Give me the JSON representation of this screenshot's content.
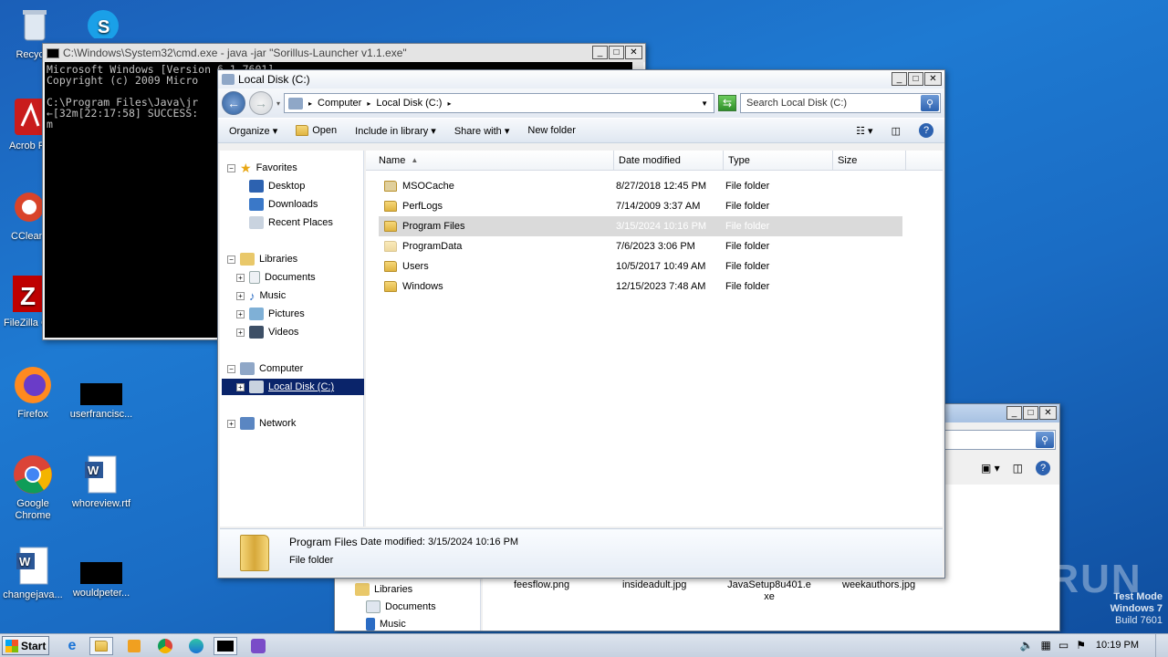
{
  "desktop": {
    "icons": [
      {
        "label": "Recycle"
      },
      {
        "label": "Acrob Reader"
      },
      {
        "label": "CClean"
      },
      {
        "label": "FileZilla C"
      },
      {
        "label": "Firefox"
      },
      {
        "label": "userfrancisc..."
      },
      {
        "label": "Google Chrome"
      },
      {
        "label": "whoreview.rtf"
      },
      {
        "label": "changejava..."
      },
      {
        "label": "wouldpeter..."
      }
    ]
  },
  "cmd_window": {
    "title": "C:\\Windows\\System32\\cmd.exe - java  -jar \"Sorillus-Launcher v1.1.exe\"",
    "lines": [
      "Microsoft Windows [Version 6.1.7601]",
      "Copyright (c) 2009 Micro",
      "",
      "C:\\Program Files\\Java\\jr",
      "←[32m[22:17:58] SUCCESS:",
      "m"
    ]
  },
  "explorer": {
    "title": "Local Disk (C:)",
    "address": {
      "crumbs": [
        "Computer",
        "Local Disk (C:)"
      ]
    },
    "search_placeholder": "Search Local Disk (C:)",
    "commands": {
      "organize": "Organize",
      "open": "Open",
      "include": "Include in library",
      "share": "Share with",
      "newfolder": "New folder"
    },
    "nav": {
      "favorites": "Favorites",
      "desktop": "Desktop",
      "downloads": "Downloads",
      "recent": "Recent Places",
      "libraries": "Libraries",
      "documents": "Documents",
      "music": "Music",
      "pictures": "Pictures",
      "videos": "Videos",
      "computer": "Computer",
      "localdisk": "Local Disk (C:)",
      "network": "Network"
    },
    "columns": {
      "name": "Name",
      "date": "Date modified",
      "type": "Type",
      "size": "Size"
    },
    "files": [
      {
        "name": "MSOCache",
        "date": "8/27/2018 12:45 PM",
        "type": "File folder"
      },
      {
        "name": "PerfLogs",
        "date": "7/14/2009 3:37 AM",
        "type": "File folder"
      },
      {
        "name": "Program Files",
        "date": "3/15/2024 10:16 PM",
        "type": "File folder"
      },
      {
        "name": "ProgramData",
        "date": "7/6/2023 3:06 PM",
        "type": "File folder"
      },
      {
        "name": "Users",
        "date": "10/5/2017 10:49 AM",
        "type": "File folder"
      },
      {
        "name": "Windows",
        "date": "12/15/2023 7:48 AM",
        "type": "File folder"
      }
    ],
    "details": {
      "name": "Program Files",
      "date_label": "Date modified:",
      "date": "3/15/2024 10:16 PM",
      "type": "File folder"
    }
  },
  "back_window": {
    "nav": {
      "libraries": "Libraries",
      "documents": "Documents",
      "music": "Music"
    },
    "files": [
      "feesflow.png",
      "insideadult.jpg",
      "JavaSetup8u401.e xe",
      "weekauthors.jpg"
    ]
  },
  "watermark": {
    "brand": "ANY RUN",
    "line1": "Test Mode",
    "line2": "Windows 7",
    "line3": "Build 7601"
  },
  "taskbar": {
    "start": "Start",
    "clock": "10:19 PM"
  }
}
